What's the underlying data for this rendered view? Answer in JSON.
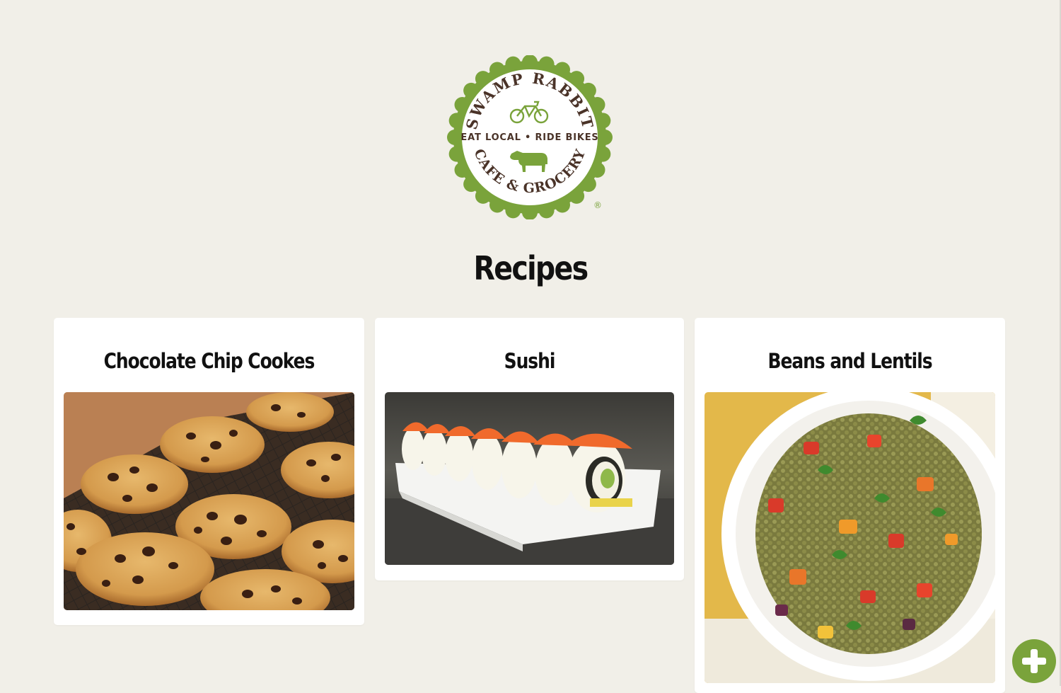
{
  "logo": {
    "arc_top": "SWAMP RABBIT",
    "tagline": "EAT LOCAL • RIDE BIKES",
    "arc_bottom": "CAFE & GROCERY",
    "registered": "®",
    "brand_color": "#7aa33b",
    "text_color": "#4a3328"
  },
  "page": {
    "title": "Recipes",
    "background": "#f1efe8"
  },
  "recipes": [
    {
      "title": "Chocolate Chip Cookes",
      "image": "chocolate-chip-cookies-photo"
    },
    {
      "title": "Sushi",
      "image": "sushi-rolls-photo"
    },
    {
      "title": "Beans and Lentils",
      "image": "lentil-salad-photo"
    }
  ],
  "add_button": {
    "icon": "plus-icon",
    "color": "#7aa33b"
  }
}
